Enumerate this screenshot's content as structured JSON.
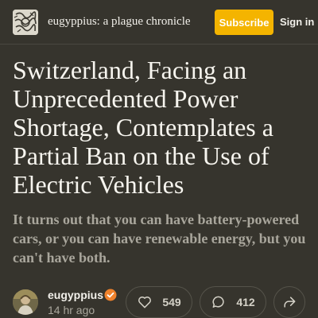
{
  "header": {
    "publication_name": "eugyppius: a plague chronicle",
    "subscribe_label": "Subscribe",
    "signin_label": "Sign in",
    "logo_icon": "publication-logo-icon"
  },
  "post": {
    "title": "Switzerland, Facing an Unprecedented Power Shortage, Contemplates a Partial Ban on the Use of Electric Vehicles",
    "subtitle": "It turns out that you can have battery-powered cars, or you can have renewable energy, but you can't have both."
  },
  "byline": {
    "author": "eugyppius",
    "time": "14 hr ago",
    "verified_icon": "verified-badge-icon"
  },
  "actions": {
    "likes": "549",
    "comments": "412",
    "like_icon": "heart-icon",
    "comment_icon": "comment-bubble-icon",
    "share_icon": "share-arrow-icon"
  },
  "colors": {
    "background": "#36342d",
    "accent": "#f4b400",
    "text": "#f2f0ea",
    "muted": "#a9a69c"
  }
}
